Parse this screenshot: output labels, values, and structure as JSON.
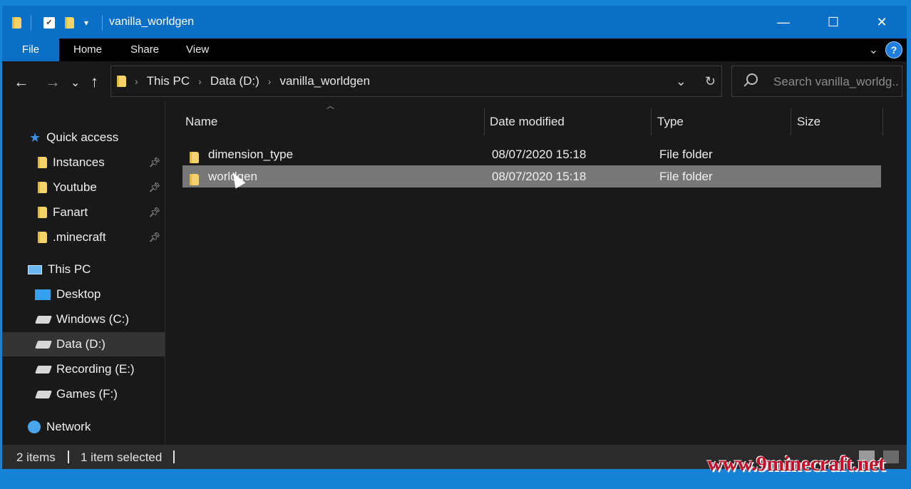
{
  "window": {
    "title": "vanilla_worldgen",
    "controls": [
      "—",
      "☐",
      "✕"
    ]
  },
  "ribbon": {
    "tabs": [
      "File",
      "Home",
      "Share",
      "View"
    ],
    "help": "?"
  },
  "nav": {
    "back": "←",
    "forward": "→",
    "recent": "⌄",
    "up": "↑"
  },
  "address": {
    "crumbs": [
      "This PC",
      "Data (D:)",
      "vanilla_worldgen"
    ]
  },
  "search": {
    "placeholder": "Search vanilla_worldg..."
  },
  "sidebar": {
    "quick_access": "Quick access",
    "pinned": [
      "Instances",
      "Youtube",
      "Fanart",
      ".minecraft"
    ],
    "this_pc": "This PC",
    "drives": [
      "Desktop",
      "Windows (C:)",
      "Data (D:)",
      "Recording (E:)",
      "Games (F:)"
    ],
    "network": "Network",
    "selected": "Data (D:)"
  },
  "columns": [
    "Name",
    "Date modified",
    "Type",
    "Size"
  ],
  "files": [
    {
      "name": "dimension_type",
      "date": "08/07/2020 15:18",
      "type": "File folder",
      "size": ""
    },
    {
      "name": "worldgen",
      "date": "08/07/2020 15:18",
      "type": "File folder",
      "size": "",
      "selected": true
    }
  ],
  "status": {
    "count": "2 items",
    "selection": "1 item selected"
  },
  "watermark": "www.9minecraft.net"
}
